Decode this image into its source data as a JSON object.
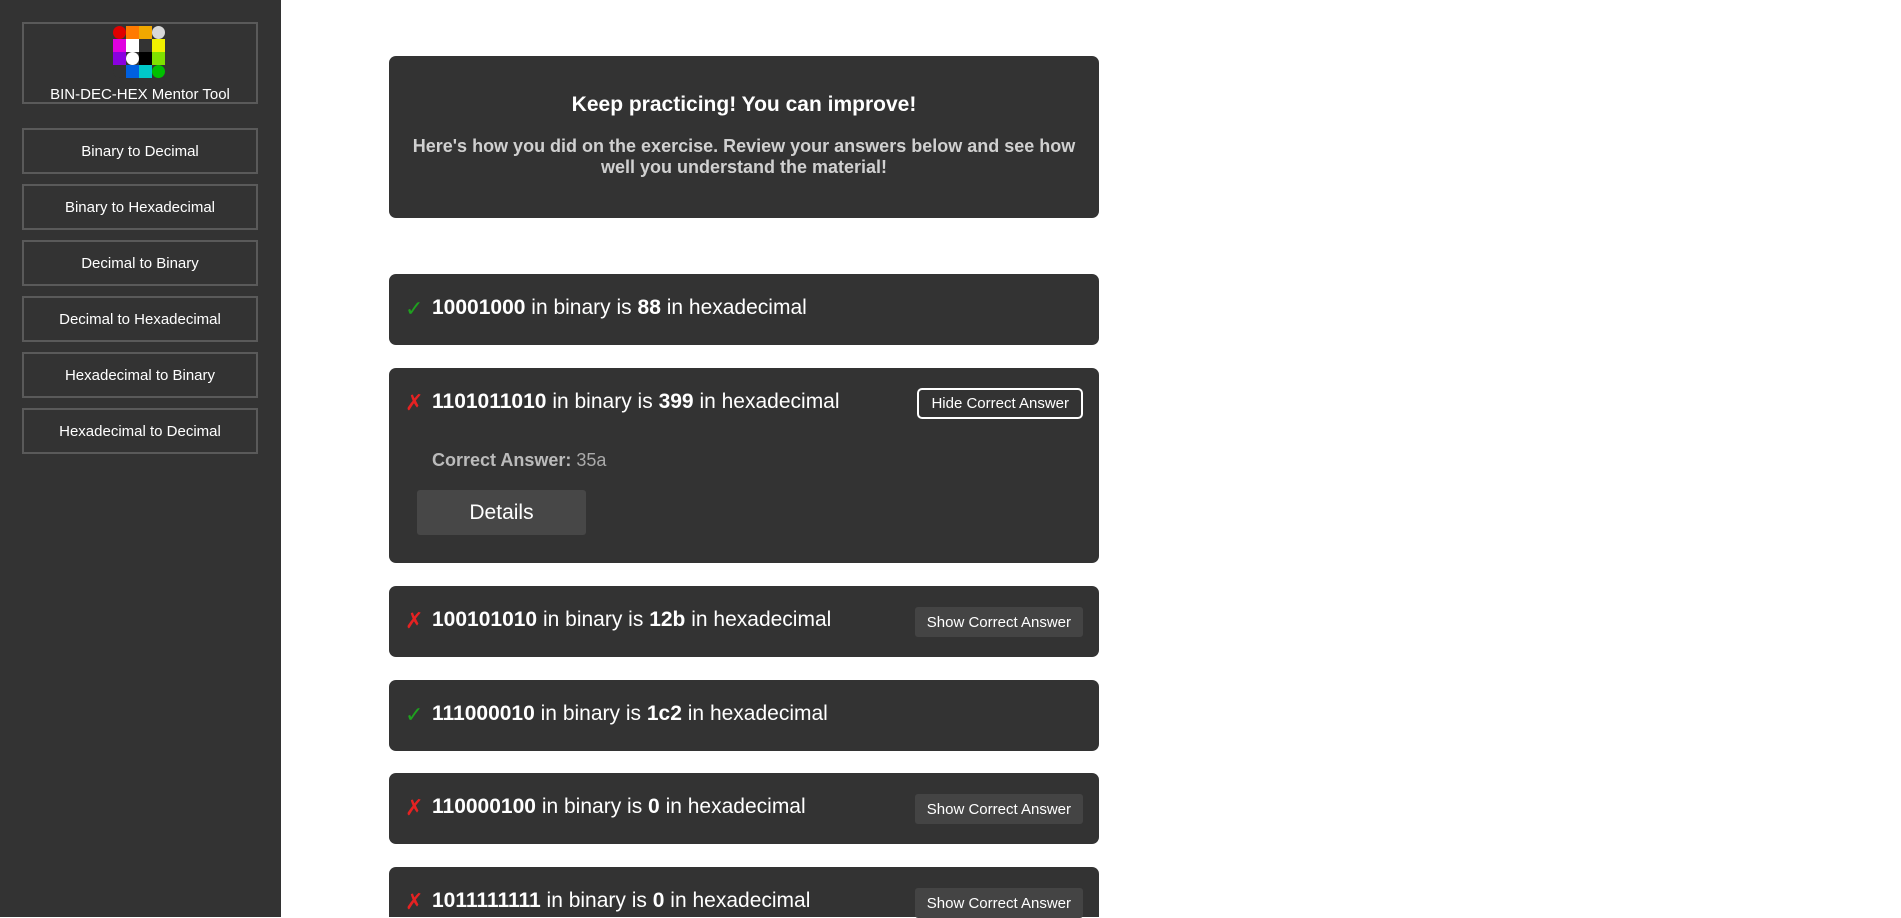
{
  "app": {
    "title": "BIN-DEC-HEX Mentor Tool",
    "logo_colors": [
      "#e00000",
      "#ff7a00",
      "#f0a800",
      "#d8d8d8",
      "#e000e0",
      "#ffffff",
      "#333333",
      "#f0f000",
      "#8a00e0",
      "#ffffff",
      "#000000",
      "#80e000",
      "#333333",
      "#0060e0",
      "#00c8c8",
      "#00c000"
    ]
  },
  "sidebar": {
    "items": [
      {
        "label": "Binary to Decimal"
      },
      {
        "label": "Binary to Hexadecimal"
      },
      {
        "label": "Decimal to Binary"
      },
      {
        "label": "Decimal to Hexadecimal"
      },
      {
        "label": "Hexadecimal to Binary"
      },
      {
        "label": "Hexadecimal to Decimal"
      }
    ]
  },
  "header": {
    "title": "Keep practicing! You can improve!",
    "subtitle": "Here's how you did on the exercise. Review your answers below and see how well you understand the material!"
  },
  "results": [
    {
      "status": "correct",
      "mark": "✓",
      "value": "10001000",
      "mid": "in binary is",
      "answer": "88",
      "end": "in hexadecimal",
      "button": ""
    },
    {
      "status": "wrong",
      "mark": "✗",
      "value": "1101011010",
      "mid": "in binary is",
      "answer": "399",
      "end": "in hexadecimal",
      "button": "Hide Correct Answer",
      "correct_label": "Correct Answer:",
      "correct_value": "35a",
      "details_label": "Details"
    },
    {
      "status": "wrong",
      "mark": "✗",
      "value": "100101010",
      "mid": "in binary is",
      "answer": "12b",
      "end": "in hexadecimal",
      "button": "Show Correct Answer"
    },
    {
      "status": "correct",
      "mark": "✓",
      "value": "111000010",
      "mid": "in binary is",
      "answer": "1c2",
      "end": "in hexadecimal",
      "button": ""
    },
    {
      "status": "wrong",
      "mark": "✗",
      "value": "110000100",
      "mid": "in binary is",
      "answer": "0",
      "end": "in hexadecimal",
      "button": "Show Correct Answer"
    },
    {
      "status": "wrong",
      "mark": "✗",
      "value": "1011111111",
      "mid": "in binary is",
      "answer": "0",
      "end": "in hexadecimal",
      "button": "Show Correct Answer"
    }
  ]
}
